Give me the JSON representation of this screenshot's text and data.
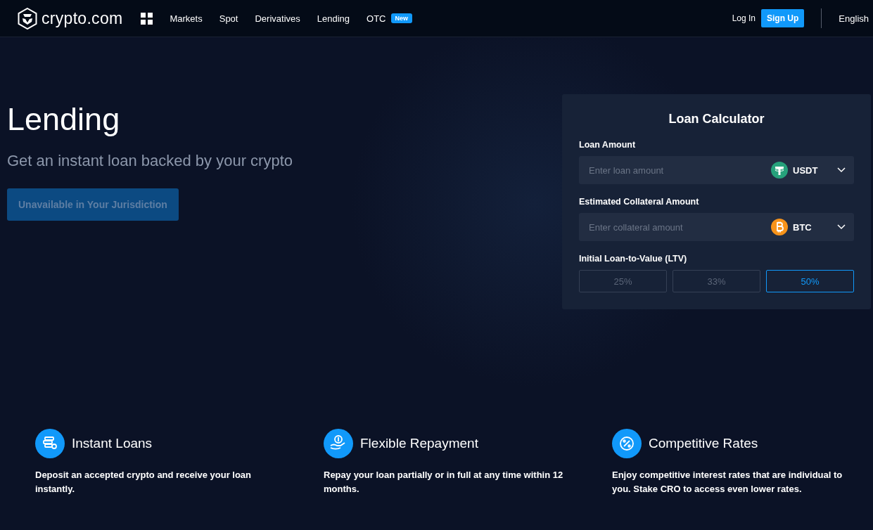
{
  "nav": {
    "logo": "crypto.com",
    "items": [
      {
        "label": "Markets"
      },
      {
        "label": "Spot"
      },
      {
        "label": "Derivatives"
      },
      {
        "label": "Lending"
      },
      {
        "label": "OTC",
        "badge": "New"
      }
    ],
    "login": "Log In",
    "signup": "Sign Up",
    "language": "English"
  },
  "hero": {
    "title": "Lending",
    "subtitle": "Get an instant loan backed by your crypto",
    "button": {
      "label": "Unavailable in Your Jurisdiction",
      "disabled": true
    }
  },
  "calculator": {
    "title": "Loan Calculator",
    "fields": [
      {
        "label": "Loan Amount",
        "placeholder": "Enter loan amount",
        "coin": "USDT",
        "kind": "tether"
      },
      {
        "label": "Estimated Collateral Amount",
        "placeholder": "Enter collateral amount",
        "coin": "BTC",
        "kind": "bitcoin"
      }
    ],
    "ltv_label": "Initial Loan-to-Value (LTV)",
    "ltv_options": [
      {
        "label": "25%",
        "selected": false
      },
      {
        "label": "33%",
        "selected": false
      },
      {
        "label": "50%",
        "selected": true
      }
    ]
  },
  "features": [
    {
      "kind": "coins",
      "title": "Instant Loans",
      "text": "Deposit an accepted crypto and receive your loan instantly."
    },
    {
      "kind": "hand",
      "title": "Flexible Repayment",
      "text": "Repay your loan partially or in full at any time within 12 months."
    },
    {
      "kind": "percent",
      "title": "Competitive Rates",
      "text": "Enjoy competitive interest rates that are individual to you. Stake CRO to access even lower rates."
    }
  ]
}
